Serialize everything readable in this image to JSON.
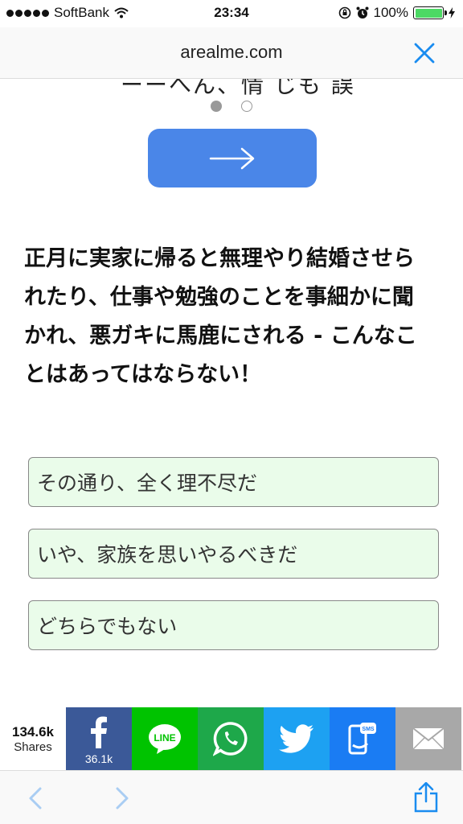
{
  "status": {
    "carrier": "SoftBank",
    "time": "23:34",
    "battery": "100%",
    "battery_level": 1.0
  },
  "nav": {
    "title": "arealme.com"
  },
  "content": {
    "cut_text": "ーーへん、情 じも 誤",
    "pager": {
      "current": 1,
      "total": 2
    },
    "question": "正月に実家に帰ると無理やり結婚させられたり、仕事や勉強のことを事細かに聞かれ、悪ガキに馬鹿にされる - こんなことはあってはならない！",
    "options": [
      {
        "label": "その通り、全く理不尽だ"
      },
      {
        "label": "いや、家族を思いやるべきだ"
      },
      {
        "label": "どちらでもない"
      }
    ]
  },
  "share": {
    "count": "134.6k",
    "count_label": "Shares",
    "facebook_count": "36.1k",
    "line_label": "LINE",
    "sms_label": "SMS",
    "colors": {
      "facebook": "#3b5998",
      "line": "#00c300",
      "whatsapp": "#1ea84a",
      "twitter": "#1da1f2",
      "sms": "#1a7cf3",
      "email": "#a8a8a8"
    }
  },
  "colors": {
    "accent": "#1a8cf0",
    "button": "#4a86e8",
    "option_bg": "#eafcea"
  }
}
